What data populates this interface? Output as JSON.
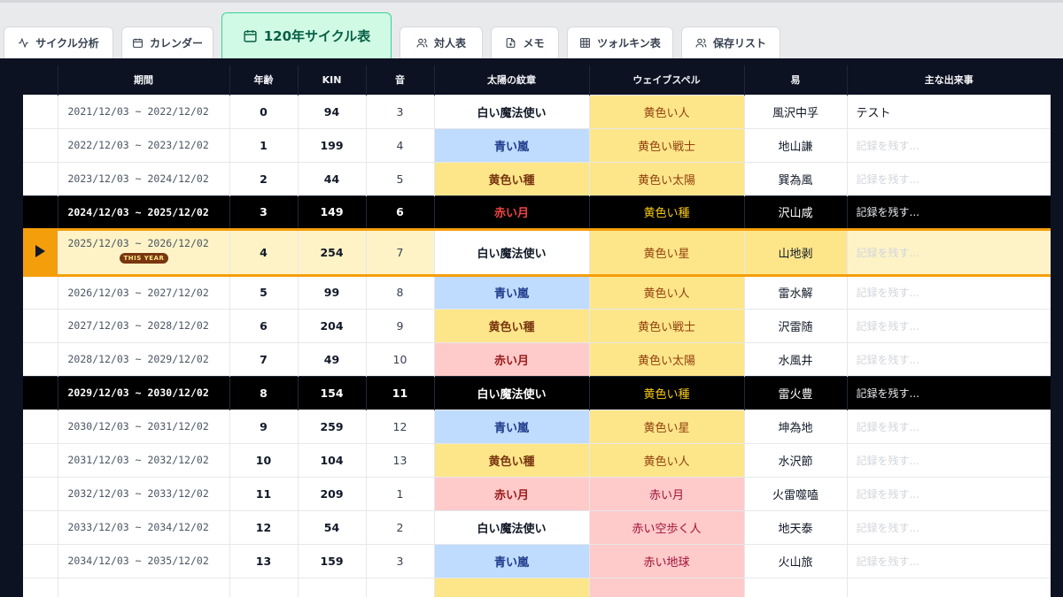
{
  "tabs": [
    {
      "label": "サイクル分析",
      "icon": "activity-icon"
    },
    {
      "label": "カレンダー",
      "icon": "calendar-icon"
    },
    {
      "label": "120年サイクル表",
      "icon": "calendar-icon",
      "active": true
    },
    {
      "label": "対人表",
      "icon": "users-icon"
    },
    {
      "label": "メモ",
      "icon": "note-add-icon"
    },
    {
      "label": "ツォルキン表",
      "icon": "grid-icon"
    },
    {
      "label": "保存リスト",
      "icon": "users-icon"
    }
  ],
  "table": {
    "headers": [
      "",
      "期間",
      "年齢",
      "KIN",
      "音",
      "太陽の紋章",
      "ウェイブスペル",
      "易",
      "主な出来事"
    ],
    "current_badge": "THIS YEAR",
    "event_placeholder": "記録を残す...",
    "rows": [
      {
        "period": "2021/12/03 ~ 2022/12/02",
        "age": "0",
        "kin": "94",
        "tone": "3",
        "seal": "白い魔法使い",
        "seal_color": "white",
        "wave": "黄色い人",
        "wave_color": "yellow",
        "iching": "風沢中孚",
        "event": "テスト",
        "style": "normal"
      },
      {
        "period": "2022/12/03 ~ 2023/12/02",
        "age": "1",
        "kin": "199",
        "tone": "4",
        "seal": "青い嵐",
        "seal_color": "blue",
        "wave": "黄色い戦士",
        "wave_color": "yellow",
        "iching": "地山謙",
        "event": "記録を残す...",
        "style": "normal"
      },
      {
        "period": "2023/12/03 ~ 2024/12/02",
        "age": "2",
        "kin": "44",
        "tone": "5",
        "seal": "黄色い種",
        "seal_color": "yellow",
        "wave": "黄色い太陽",
        "wave_color": "yellow",
        "iching": "巽為風",
        "event": "記録を残す...",
        "style": "normal"
      },
      {
        "period": "2024/12/03 ~ 2025/12/02",
        "age": "3",
        "kin": "149",
        "tone": "6",
        "seal": "赤い月",
        "seal_color": "red",
        "wave": "黄色い種",
        "wave_color": "yellow",
        "iching": "沢山咸",
        "event": "記録を残す...",
        "style": "dark"
      },
      {
        "period": "2025/12/03 ~ 2026/12/02",
        "age": "4",
        "kin": "254",
        "tone": "7",
        "seal": "白い魔法使い",
        "seal_color": "white",
        "wave": "黄色い星",
        "wave_color": "yellow",
        "iching": "山地剥",
        "event": "記録を残す...",
        "style": "current"
      },
      {
        "period": "2026/12/03 ~ 2027/12/02",
        "age": "5",
        "kin": "99",
        "tone": "8",
        "seal": "青い嵐",
        "seal_color": "blue",
        "wave": "黄色い人",
        "wave_color": "yellow",
        "iching": "雷水解",
        "event": "記録を残す...",
        "style": "normal"
      },
      {
        "period": "2027/12/03 ~ 2028/12/02",
        "age": "6",
        "kin": "204",
        "tone": "9",
        "seal": "黄色い種",
        "seal_color": "yellow",
        "wave": "黄色い戦士",
        "wave_color": "yellow",
        "iching": "沢雷随",
        "event": "記録を残す...",
        "style": "normal"
      },
      {
        "period": "2028/12/03 ~ 2029/12/02",
        "age": "7",
        "kin": "49",
        "tone": "10",
        "seal": "赤い月",
        "seal_color": "red",
        "wave": "黄色い太陽",
        "wave_color": "yellow",
        "iching": "水風井",
        "event": "記録を残す...",
        "style": "normal"
      },
      {
        "period": "2029/12/03 ~ 2030/12/02",
        "age": "8",
        "kin": "154",
        "tone": "11",
        "seal": "白い魔法使い",
        "seal_color": "white",
        "wave": "黄色い種",
        "wave_color": "yellow",
        "iching": "雷火豊",
        "event": "記録を残す...",
        "style": "dark"
      },
      {
        "period": "2030/12/03 ~ 2031/12/02",
        "age": "9",
        "kin": "259",
        "tone": "12",
        "seal": "青い嵐",
        "seal_color": "blue",
        "wave": "黄色い星",
        "wave_color": "yellow",
        "iching": "坤為地",
        "event": "記録を残す...",
        "style": "normal"
      },
      {
        "period": "2031/12/03 ~ 2032/12/02",
        "age": "10",
        "kin": "104",
        "tone": "13",
        "seal": "黄色い種",
        "seal_color": "yellow",
        "wave": "黄色い人",
        "wave_color": "yellow",
        "iching": "水沢節",
        "event": "記録を残す...",
        "style": "normal"
      },
      {
        "period": "2032/12/03 ~ 2033/12/02",
        "age": "11",
        "kin": "209",
        "tone": "1",
        "seal": "赤い月",
        "seal_color": "red",
        "wave": "赤い月",
        "wave_color": "red",
        "iching": "火雷噬嗑",
        "event": "記録を残す...",
        "style": "normal"
      },
      {
        "period": "2033/12/03 ~ 2034/12/02",
        "age": "12",
        "kin": "54",
        "tone": "2",
        "seal": "白い魔法使い",
        "seal_color": "white",
        "wave": "赤い空歩く人",
        "wave_color": "red",
        "iching": "地天泰",
        "event": "記録を残す...",
        "style": "normal"
      },
      {
        "period": "2034/12/03 ~ 2035/12/02",
        "age": "13",
        "kin": "159",
        "tone": "3",
        "seal": "青い嵐",
        "seal_color": "blue",
        "wave": "赤い地球",
        "wave_color": "red",
        "iching": "火山旅",
        "event": "記録を残す...",
        "style": "normal"
      },
      {
        "period": "",
        "age": "",
        "kin": "",
        "tone": "",
        "seal": "",
        "seal_color": "yellow",
        "wave": "",
        "wave_color": "red",
        "iching": "",
        "event": "",
        "style": "normal"
      }
    ]
  }
}
